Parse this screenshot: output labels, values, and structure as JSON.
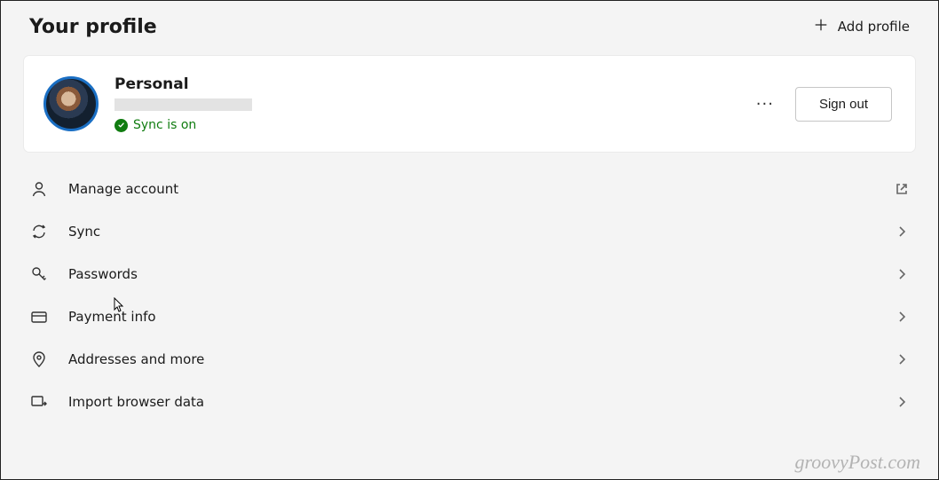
{
  "header": {
    "title": "Your profile",
    "add_profile_label": "Add profile"
  },
  "profile": {
    "name": "Personal",
    "sync_status": "Sync is on",
    "signout_label": "Sign out"
  },
  "menu": [
    {
      "id": "manage-account",
      "label": "Manage account",
      "trailing": "external"
    },
    {
      "id": "sync",
      "label": "Sync",
      "trailing": "chevron"
    },
    {
      "id": "passwords",
      "label": "Passwords",
      "trailing": "chevron"
    },
    {
      "id": "payment-info",
      "label": "Payment info",
      "trailing": "chevron"
    },
    {
      "id": "addresses",
      "label": "Addresses and more",
      "trailing": "chevron"
    },
    {
      "id": "import-data",
      "label": "Import browser data",
      "trailing": "chevron"
    }
  ],
  "watermark": "groovyPost.com"
}
